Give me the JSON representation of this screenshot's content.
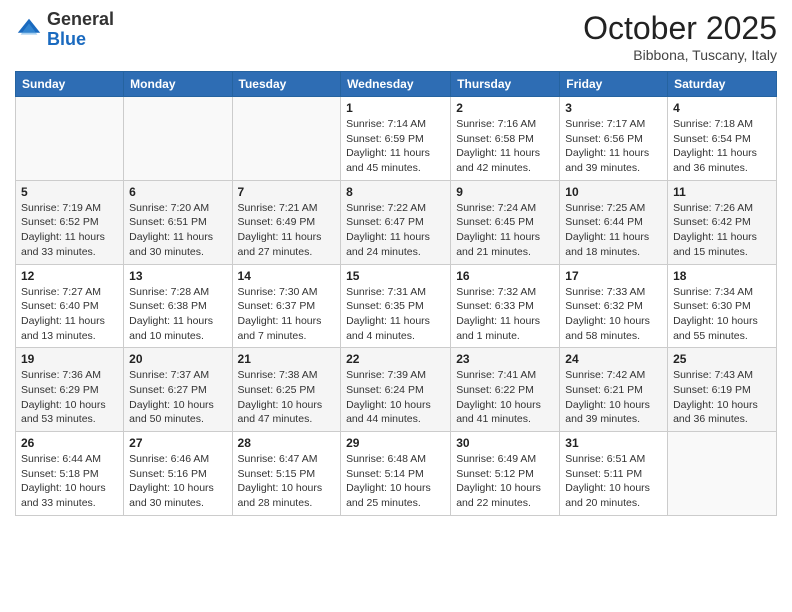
{
  "logo": {
    "general": "General",
    "blue": "Blue"
  },
  "header": {
    "month": "October 2025",
    "location": "Bibbona, Tuscany, Italy"
  },
  "days_of_week": [
    "Sunday",
    "Monday",
    "Tuesday",
    "Wednesday",
    "Thursday",
    "Friday",
    "Saturday"
  ],
  "weeks": [
    [
      {
        "day": "",
        "info": ""
      },
      {
        "day": "",
        "info": ""
      },
      {
        "day": "",
        "info": ""
      },
      {
        "day": "1",
        "info": "Sunrise: 7:14 AM\nSunset: 6:59 PM\nDaylight: 11 hours and 45 minutes."
      },
      {
        "day": "2",
        "info": "Sunrise: 7:16 AM\nSunset: 6:58 PM\nDaylight: 11 hours and 42 minutes."
      },
      {
        "day": "3",
        "info": "Sunrise: 7:17 AM\nSunset: 6:56 PM\nDaylight: 11 hours and 39 minutes."
      },
      {
        "day": "4",
        "info": "Sunrise: 7:18 AM\nSunset: 6:54 PM\nDaylight: 11 hours and 36 minutes."
      }
    ],
    [
      {
        "day": "5",
        "info": "Sunrise: 7:19 AM\nSunset: 6:52 PM\nDaylight: 11 hours and 33 minutes."
      },
      {
        "day": "6",
        "info": "Sunrise: 7:20 AM\nSunset: 6:51 PM\nDaylight: 11 hours and 30 minutes."
      },
      {
        "day": "7",
        "info": "Sunrise: 7:21 AM\nSunset: 6:49 PM\nDaylight: 11 hours and 27 minutes."
      },
      {
        "day": "8",
        "info": "Sunrise: 7:22 AM\nSunset: 6:47 PM\nDaylight: 11 hours and 24 minutes."
      },
      {
        "day": "9",
        "info": "Sunrise: 7:24 AM\nSunset: 6:45 PM\nDaylight: 11 hours and 21 minutes."
      },
      {
        "day": "10",
        "info": "Sunrise: 7:25 AM\nSunset: 6:44 PM\nDaylight: 11 hours and 18 minutes."
      },
      {
        "day": "11",
        "info": "Sunrise: 7:26 AM\nSunset: 6:42 PM\nDaylight: 11 hours and 15 minutes."
      }
    ],
    [
      {
        "day": "12",
        "info": "Sunrise: 7:27 AM\nSunset: 6:40 PM\nDaylight: 11 hours and 13 minutes."
      },
      {
        "day": "13",
        "info": "Sunrise: 7:28 AM\nSunset: 6:38 PM\nDaylight: 11 hours and 10 minutes."
      },
      {
        "day": "14",
        "info": "Sunrise: 7:30 AM\nSunset: 6:37 PM\nDaylight: 11 hours and 7 minutes."
      },
      {
        "day": "15",
        "info": "Sunrise: 7:31 AM\nSunset: 6:35 PM\nDaylight: 11 hours and 4 minutes."
      },
      {
        "day": "16",
        "info": "Sunrise: 7:32 AM\nSunset: 6:33 PM\nDaylight: 11 hours and 1 minute."
      },
      {
        "day": "17",
        "info": "Sunrise: 7:33 AM\nSunset: 6:32 PM\nDaylight: 10 hours and 58 minutes."
      },
      {
        "day": "18",
        "info": "Sunrise: 7:34 AM\nSunset: 6:30 PM\nDaylight: 10 hours and 55 minutes."
      }
    ],
    [
      {
        "day": "19",
        "info": "Sunrise: 7:36 AM\nSunset: 6:29 PM\nDaylight: 10 hours and 53 minutes."
      },
      {
        "day": "20",
        "info": "Sunrise: 7:37 AM\nSunset: 6:27 PM\nDaylight: 10 hours and 50 minutes."
      },
      {
        "day": "21",
        "info": "Sunrise: 7:38 AM\nSunset: 6:25 PM\nDaylight: 10 hours and 47 minutes."
      },
      {
        "day": "22",
        "info": "Sunrise: 7:39 AM\nSunset: 6:24 PM\nDaylight: 10 hours and 44 minutes."
      },
      {
        "day": "23",
        "info": "Sunrise: 7:41 AM\nSunset: 6:22 PM\nDaylight: 10 hours and 41 minutes."
      },
      {
        "day": "24",
        "info": "Sunrise: 7:42 AM\nSunset: 6:21 PM\nDaylight: 10 hours and 39 minutes."
      },
      {
        "day": "25",
        "info": "Sunrise: 7:43 AM\nSunset: 6:19 PM\nDaylight: 10 hours and 36 minutes."
      }
    ],
    [
      {
        "day": "26",
        "info": "Sunrise: 6:44 AM\nSunset: 5:18 PM\nDaylight: 10 hours and 33 minutes."
      },
      {
        "day": "27",
        "info": "Sunrise: 6:46 AM\nSunset: 5:16 PM\nDaylight: 10 hours and 30 minutes."
      },
      {
        "day": "28",
        "info": "Sunrise: 6:47 AM\nSunset: 5:15 PM\nDaylight: 10 hours and 28 minutes."
      },
      {
        "day": "29",
        "info": "Sunrise: 6:48 AM\nSunset: 5:14 PM\nDaylight: 10 hours and 25 minutes."
      },
      {
        "day": "30",
        "info": "Sunrise: 6:49 AM\nSunset: 5:12 PM\nDaylight: 10 hours and 22 minutes."
      },
      {
        "day": "31",
        "info": "Sunrise: 6:51 AM\nSunset: 5:11 PM\nDaylight: 10 hours and 20 minutes."
      },
      {
        "day": "",
        "info": ""
      }
    ]
  ]
}
